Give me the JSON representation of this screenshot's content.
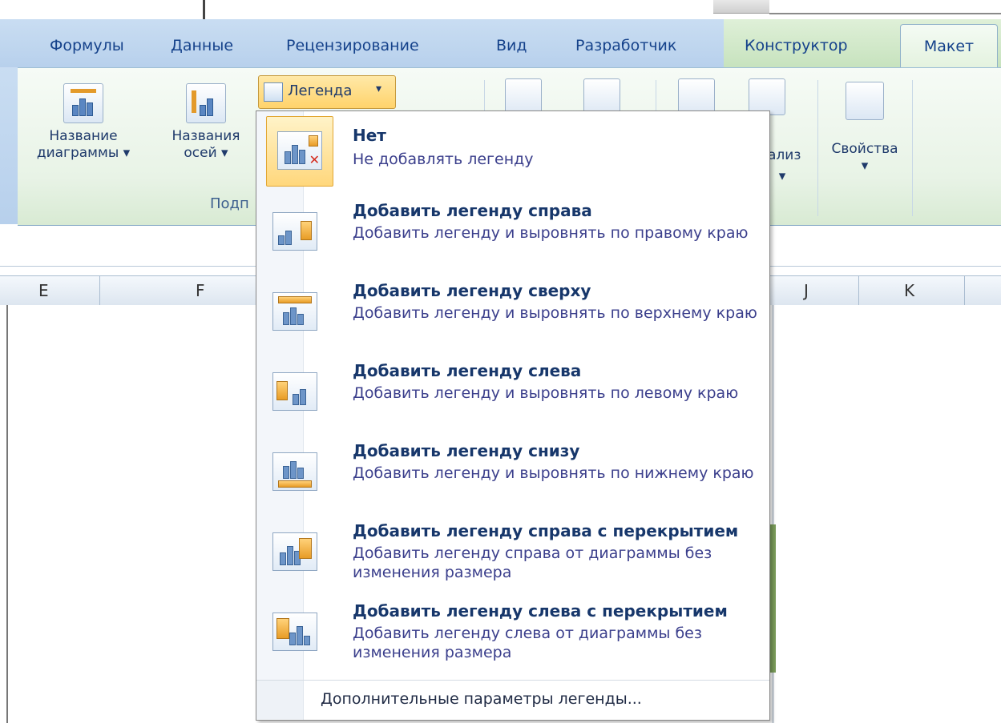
{
  "tabs": [
    {
      "label": "Формулы"
    },
    {
      "label": "Данные"
    },
    {
      "label": "Рецензирование"
    },
    {
      "label": "Вид"
    },
    {
      "label": "Разработчик"
    },
    {
      "label": "Конструктор"
    },
    {
      "label": "Макет",
      "active": true
    }
  ],
  "ribbon": {
    "chart_title_btn": "Название\nдиаграммы ▾",
    "chart_title_l1": "Название",
    "chart_title_l2": "диаграммы ▾",
    "axes_title_l1": "Названия",
    "axes_title_l2": "осей ▾",
    "group_label_partial": "Подп",
    "legend_btn": "Легенда",
    "analysis_partial": "ализ",
    "properties_btn": "Свойства"
  },
  "columns": [
    "E",
    "F",
    "J",
    "K"
  ],
  "menu": {
    "items": [
      {
        "title": "Нет",
        "desc": "Не добавлять легенду",
        "icon": "legend-none-icon",
        "selected": true
      },
      {
        "title": "Добавить легенду справа",
        "desc": "Добавить легенду и выровнять по правому краю",
        "icon": "legend-right-icon"
      },
      {
        "title": "Добавить легенду сверху",
        "desc": "Добавить легенду и выровнять по верхнему краю",
        "icon": "legend-top-icon"
      },
      {
        "title": "Добавить легенду слева",
        "desc": "Добавить легенду и выровнять по левому краю",
        "icon": "legend-left-icon"
      },
      {
        "title": "Добавить легенду снизу",
        "desc": "Добавить легенду и выровнять по нижнему краю",
        "icon": "legend-bottom-icon"
      },
      {
        "title": "Добавить легенду справа с перекрытием",
        "desc": "Добавить легенду справа от диаграммы без изменения размера",
        "icon": "legend-right-overlay-icon"
      },
      {
        "title": "Добавить легенду слева с перекрытием",
        "desc": "Добавить легенду слева от диаграммы без изменения размера",
        "icon": "legend-left-overlay-icon"
      }
    ],
    "more_options": "Дополнительные параметры легенды..."
  },
  "colors": {
    "tab_text": "#15428b",
    "highlight": "#ffd77c",
    "menu_title": "#17376b",
    "menu_desc": "#3b3f8c"
  }
}
